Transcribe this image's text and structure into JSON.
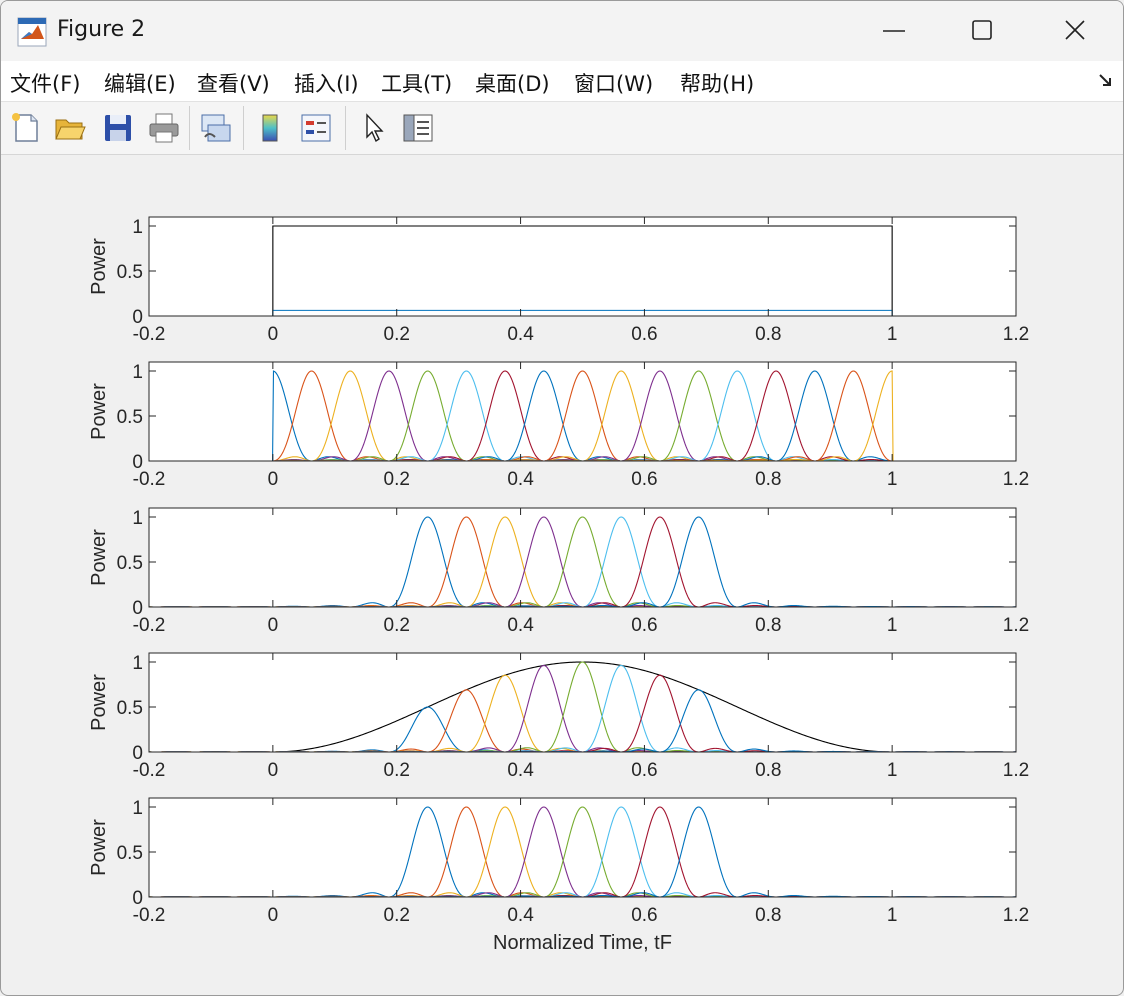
{
  "window": {
    "title": "Figure 2",
    "minimize_icon": "minimize-icon",
    "maximize_icon": "maximize-icon",
    "close_icon": "close-icon"
  },
  "menu": {
    "items": [
      "文件(F)",
      "编辑(E)",
      "查看(V)",
      "插入(I)",
      "工具(T)",
      "桌面(D)",
      "窗口(W)",
      "帮助(H)"
    ],
    "overflow_icon": "dock-arrow-icon"
  },
  "toolbar": {
    "icons": [
      "new-figure-icon",
      "open-file-icon",
      "save-icon",
      "print-icon",
      "link-plot-icon",
      "colorbar-icon",
      "legend-icon",
      "pointer-icon",
      "property-inspector-icon"
    ]
  },
  "colors": {
    "series": [
      "#0072BD",
      "#D95319",
      "#EDB120",
      "#7E2F8E",
      "#77AC30",
      "#4DBEEE",
      "#A2142F"
    ],
    "envelope": "#000000"
  },
  "chart_data": [
    {
      "type": "line",
      "ylabel": "Power",
      "xlim": [
        -0.2,
        1.2
      ],
      "ylim": [
        0,
        1.1
      ],
      "xticks": [
        "-0.2",
        "0",
        "0.2",
        "0.4",
        "0.6",
        "0.8",
        "1",
        "1.2"
      ],
      "yticks": [
        "0",
        "0.5",
        "1"
      ],
      "series": [
        {
          "kind": "rect",
          "x": [
            -0.2,
            0,
            0,
            1,
            1,
            1.2
          ],
          "y": [
            0,
            0,
            1,
            1,
            0,
            0
          ],
          "color": "envelope"
        },
        {
          "kind": "rect",
          "x": [
            -0.2,
            0,
            0,
            1,
            1,
            1.2
          ],
          "y": [
            0,
            0,
            0.0625,
            0.0625,
            0,
            0
          ],
          "color": 0
        }
      ]
    },
    {
      "type": "line",
      "ylabel": "Power",
      "xlim": [
        -0.2,
        1.2
      ],
      "ylim": [
        0,
        1.1
      ],
      "xticks": [
        "-0.2",
        "0",
        "0.2",
        "0.4",
        "0.6",
        "0.8",
        "1",
        "1.2"
      ],
      "yticks": [
        "0",
        "0.5",
        "1"
      ],
      "pulses": {
        "centers": [
          0,
          0.0625,
          0.125,
          0.1875,
          0.25,
          0.3125,
          0.375,
          0.4375,
          0.5,
          0.5625,
          0.625,
          0.6875,
          0.75,
          0.8125,
          0.875,
          0.9375,
          1.0
        ],
        "width": 0.0625,
        "support": [
          0,
          1
        ],
        "peak": 1
      }
    },
    {
      "type": "line",
      "ylabel": "Power",
      "xlim": [
        -0.2,
        1.2
      ],
      "ylim": [
        0,
        1.1
      ],
      "xticks": [
        "-0.2",
        "0",
        "0.2",
        "0.4",
        "0.6",
        "0.8",
        "1",
        "1.2"
      ],
      "yticks": [
        "0",
        "0.5",
        "1"
      ],
      "pulses": {
        "centers": [
          0.25,
          0.3125,
          0.375,
          0.4375,
          0.5,
          0.5625,
          0.625,
          0.6875
        ],
        "width": 0.0625,
        "peak": 1
      }
    },
    {
      "type": "line",
      "ylabel": "Power",
      "xlim": [
        -0.2,
        1.2
      ],
      "ylim": [
        0,
        1.1
      ],
      "xticks": [
        "-0.2",
        "0",
        "0.2",
        "0.4",
        "0.6",
        "0.8",
        "1",
        "1.2"
      ],
      "yticks": [
        "0",
        "0.5",
        "1"
      ],
      "envelope": {
        "shape": "sin^2",
        "range": [
          0,
          1
        ],
        "peak": 1
      },
      "pulses": {
        "centers": [
          0.25,
          0.3125,
          0.375,
          0.4375,
          0.5,
          0.5625,
          0.625,
          0.6875
        ],
        "width": 0.0625,
        "peak": "envelope"
      }
    },
    {
      "type": "line",
      "ylabel": "Power",
      "xlabel": "Normalized Time, tF",
      "xlim": [
        -0.2,
        1.2
      ],
      "ylim": [
        0,
        1.1
      ],
      "xticks": [
        "-0.2",
        "0",
        "0.2",
        "0.4",
        "0.6",
        "0.8",
        "1",
        "1.2"
      ],
      "yticks": [
        "0",
        "0.5",
        "1"
      ],
      "pulses": {
        "centers": [
          0.25,
          0.3125,
          0.375,
          0.4375,
          0.5,
          0.5625,
          0.625,
          0.6875
        ],
        "width": 0.0625,
        "peak": 1
      }
    }
  ]
}
